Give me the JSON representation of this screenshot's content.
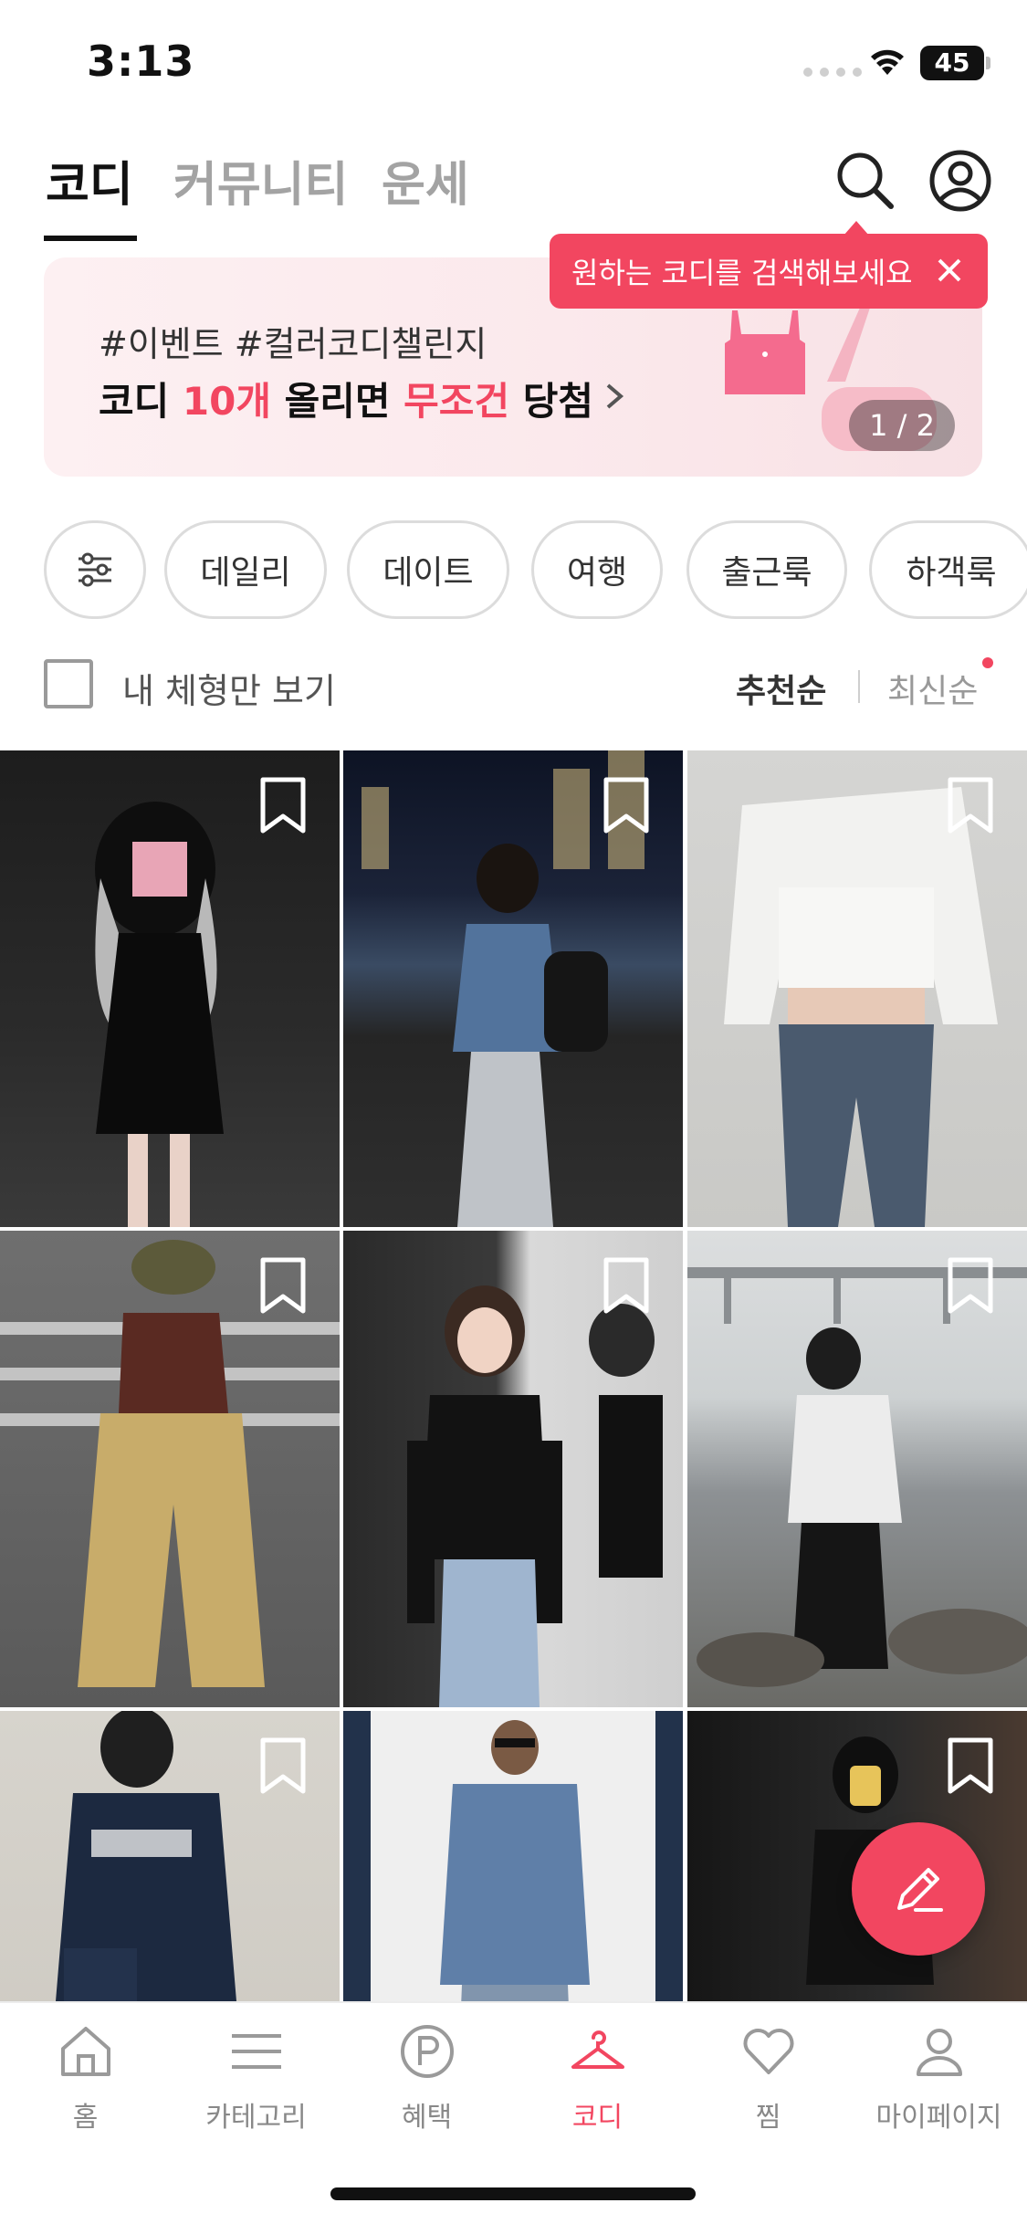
{
  "status": {
    "time": "3:13",
    "battery": "45"
  },
  "top_tabs": [
    {
      "label": "코디",
      "active": true
    },
    {
      "label": "커뮤니티",
      "active": false
    },
    {
      "label": "운세",
      "active": false
    }
  ],
  "tooltip": {
    "text": "원하는 코디를 검색해보세요"
  },
  "banner": {
    "tags": "#이벤트 #컬러코디챌린지",
    "headline_part1": "코디 ",
    "headline_red1": "10개",
    "headline_part2": " 올리면 ",
    "headline_red2": "무조건",
    "headline_part3": " 당첨",
    "pager": "1 / 2"
  },
  "chips": [
    "데일리",
    "데이트",
    "여행",
    "출근룩",
    "하객룩"
  ],
  "filter": {
    "body_type_label": "내 체형만 보기",
    "checked": false
  },
  "sort": {
    "recommended": "추천순",
    "newest": "최신순",
    "active": "recommended"
  },
  "grid": [
    {
      "label": "outfit-1"
    },
    {
      "label": "outfit-2"
    },
    {
      "label": "outfit-3"
    },
    {
      "label": "outfit-4"
    },
    {
      "label": "outfit-5"
    },
    {
      "label": "outfit-6"
    },
    {
      "label": "outfit-7"
    },
    {
      "label": "outfit-8"
    },
    {
      "label": "outfit-9"
    }
  ],
  "bottom_nav": [
    {
      "label": "홈",
      "icon": "home-icon",
      "active": false
    },
    {
      "label": "카테고리",
      "icon": "menu-icon",
      "active": false
    },
    {
      "label": "혜택",
      "icon": "points-icon",
      "active": false
    },
    {
      "label": "코디",
      "icon": "hanger-icon",
      "active": true
    },
    {
      "label": "찜",
      "icon": "heart-icon",
      "active": false
    },
    {
      "label": "마이페이지",
      "icon": "person-icon",
      "active": false
    }
  ],
  "colors": {
    "accent": "#f24660",
    "text": "#111111",
    "muted": "#a3a3a3"
  }
}
